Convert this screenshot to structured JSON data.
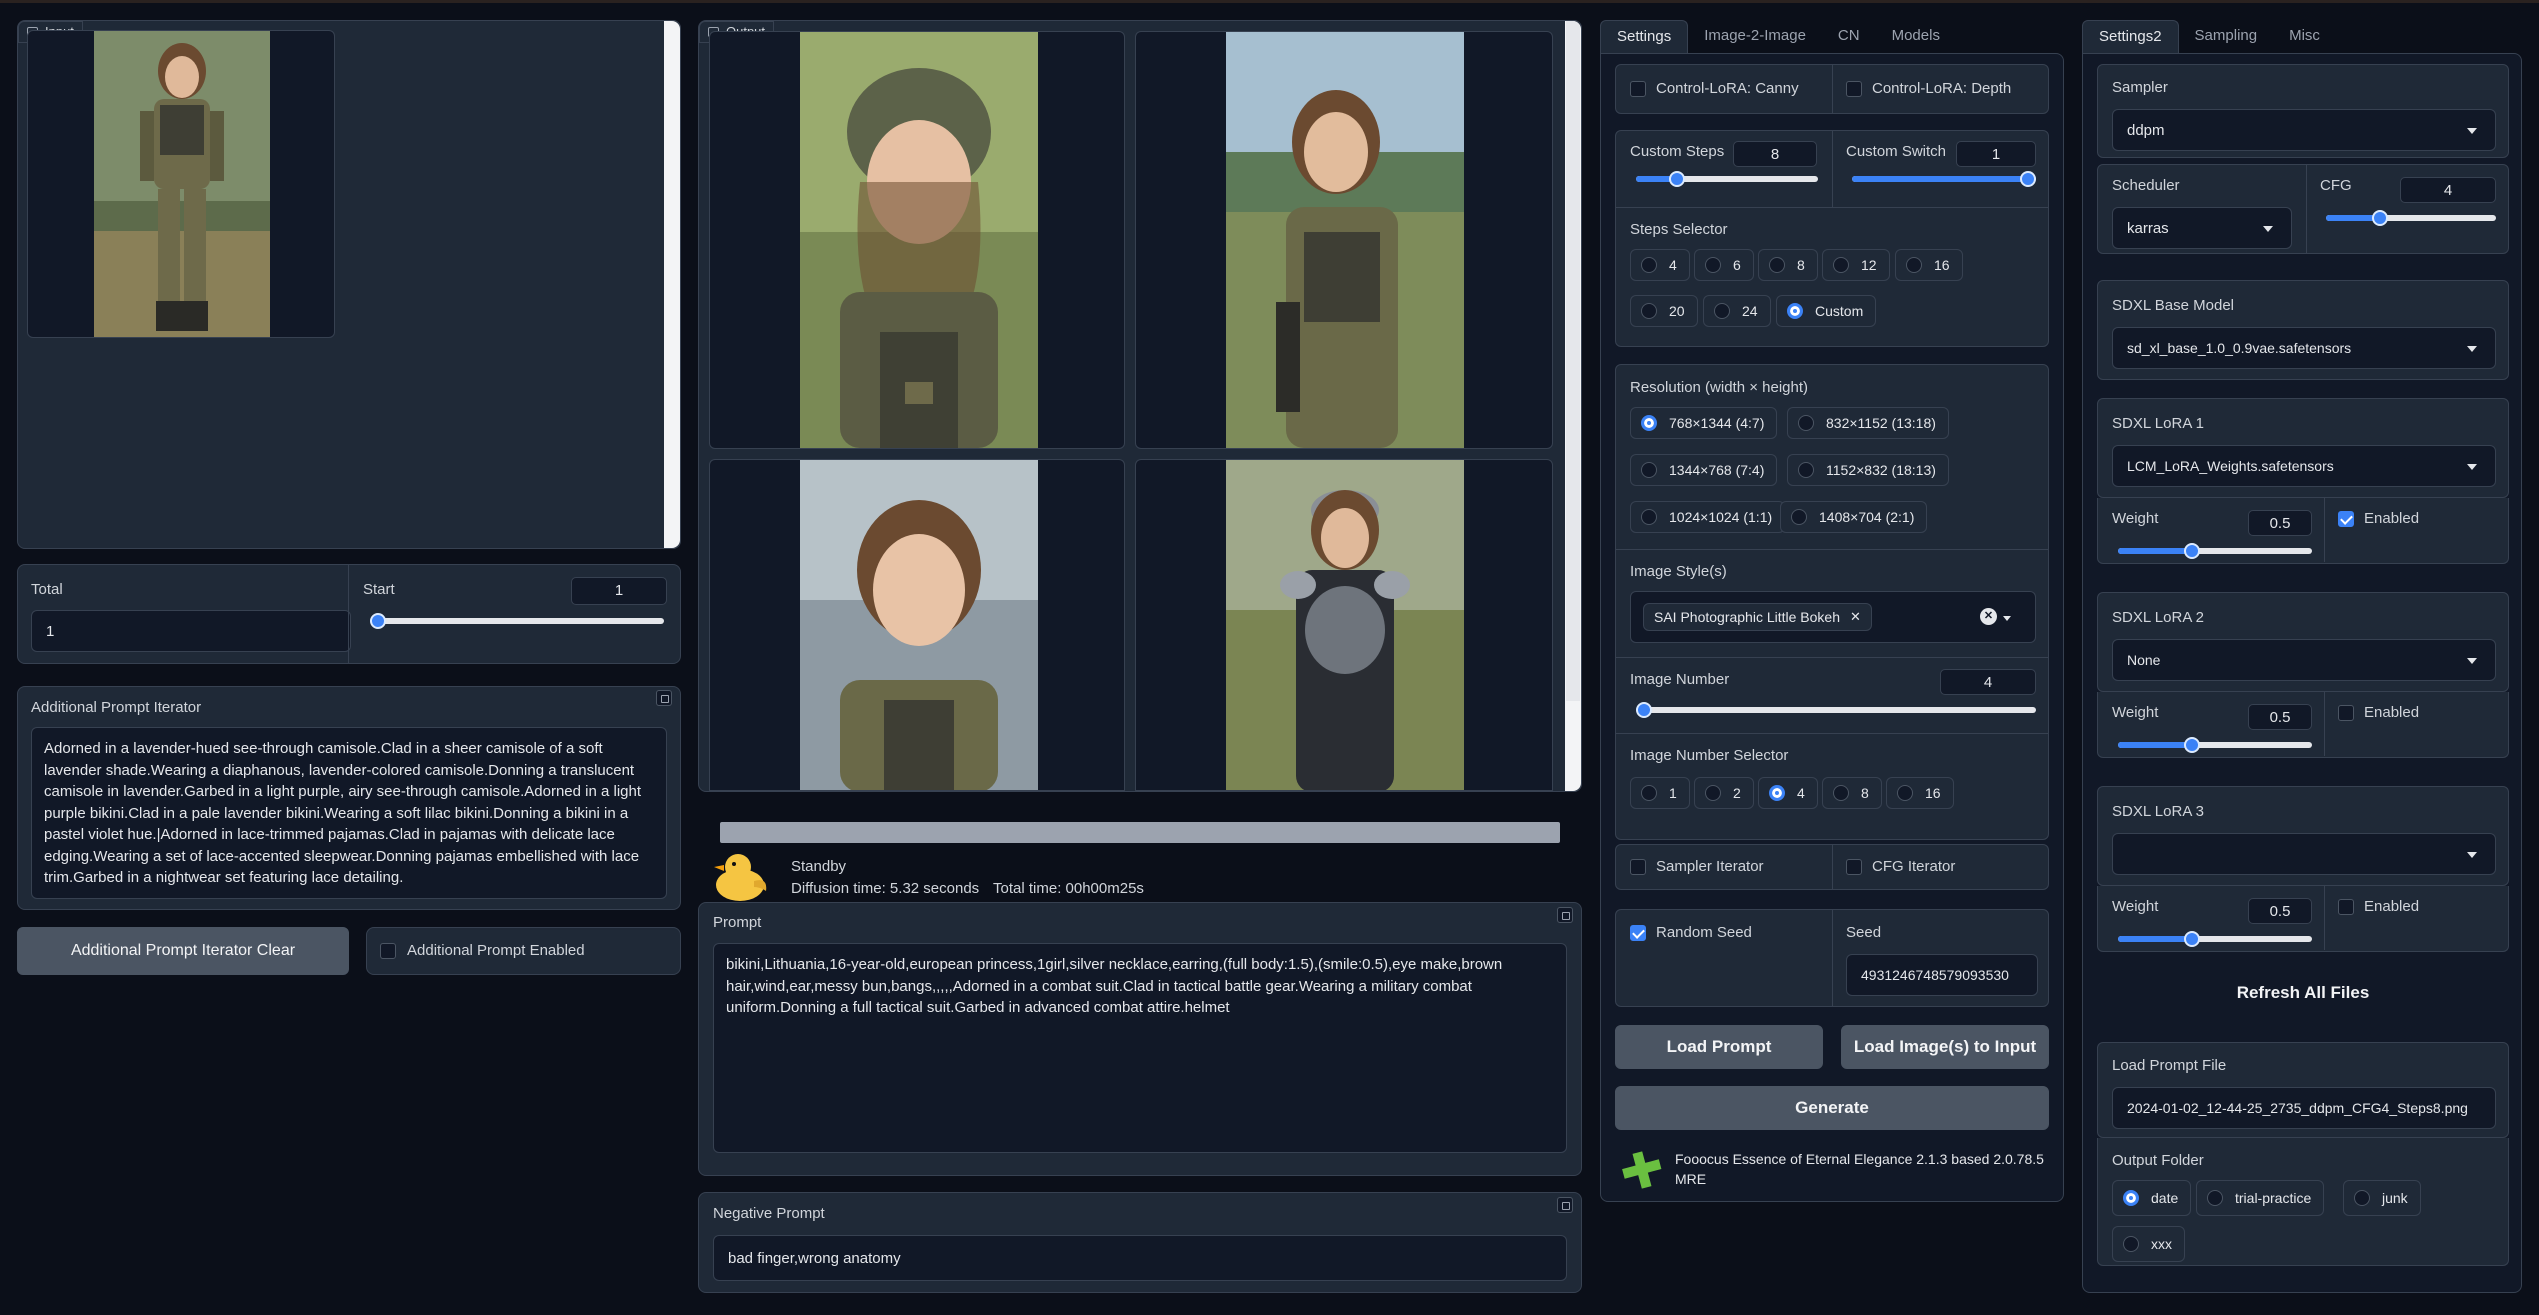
{
  "input_panel": {
    "label": "Input"
  },
  "output_panel": {
    "label": "Output"
  },
  "total": {
    "label": "Total",
    "value": "1"
  },
  "start": {
    "label": "Start",
    "value": "1",
    "fraction": 0
  },
  "iterator": {
    "label": "Additional Prompt Iterator",
    "text": "Adorned in a lavender-hued see-through camisole.Clad in a sheer camisole of a soft lavender shade.Wearing a diaphanous, lavender-colored camisole.Donning a translucent camisole in lavender.Garbed in a light purple, airy see-through camisole.Adorned in a light purple bikini.Clad in a pale lavender bikini.Wearing a soft lilac bikini.Donning a bikini in a pastel violet hue.|Adorned in lace-trimmed pajamas.Clad in pajamas with delicate lace edging.Wearing a set of lace-accented sleepwear.Donning pajamas embellished with lace trim.Garbed in a nightwear set featuring lace detailing.",
    "clear_button": "Additional Prompt Iterator Clear",
    "enabled_label": "Additional Prompt Enabled"
  },
  "status": {
    "state": "Standby",
    "diffusion": "Diffusion time: 5.32 seconds",
    "total": "Total time: 00h00m25s"
  },
  "prompt": {
    "label": "Prompt",
    "text": "bikini,Lithuania,16-year-old,european princess,1girl,silver necklace,earring,(full body:1.5),(smile:0.5),eye make,brown hair,wind,ear,messy bun,bangs,,,,,Adorned in a combat suit.Clad in tactical battle gear.Wearing a military combat uniform.Donning a full tactical suit.Garbed in advanced combat attire.helmet"
  },
  "negative": {
    "label": "Negative Prompt",
    "text": "bad finger,wrong anatomy"
  },
  "tabs_mid": [
    "Settings",
    "Image-2-Image",
    "CN",
    "Models"
  ],
  "tabs_right": [
    "Settings2",
    "Sampling",
    "Misc"
  ],
  "controlnet": {
    "canny": "Control-LoRA: Canny",
    "depth": "Control-LoRA: Depth"
  },
  "custom_steps": {
    "label": "Custom Steps",
    "value": "8",
    "fraction": 0.2
  },
  "custom_switch": {
    "label": "Custom Switch",
    "value": "1",
    "fraction": 1
  },
  "steps_selector": {
    "label": "Steps Selector",
    "options": [
      "4",
      "6",
      "8",
      "12",
      "16",
      "20",
      "24",
      "Custom"
    ],
    "selected": "Custom"
  },
  "resolution": {
    "label": "Resolution (width × height)",
    "options": [
      "768×1344 (4:7)",
      "832×1152 (13:18)",
      "1344×768 (7:4)",
      "1152×832 (18:13)",
      "1024×1024 (1:1)",
      "1408×704 (2:1)"
    ],
    "selected": "768×1344 (4:7)"
  },
  "style": {
    "label": "Image Style(s)",
    "value": "SAI Photographic Little Bokeh"
  },
  "image_number": {
    "label": "Image Number",
    "value": "4",
    "fraction": 0
  },
  "image_number_selector": {
    "label": "Image Number Selector",
    "options": [
      "1",
      "2",
      "4",
      "8",
      "16"
    ],
    "selected": "4"
  },
  "iterators": {
    "sampler": "Sampler Iterator",
    "cfg": "CFG Iterator"
  },
  "seed": {
    "random_label": "Random Seed",
    "label": "Seed",
    "value": "4931246748579093530"
  },
  "buttons": {
    "load_prompt": "Load Prompt",
    "load_images": "Load Image(s) to Input",
    "generate": "Generate"
  },
  "version": {
    "text": "Fooocus Essence of Eternal Elegance 2.1.3 based 2.0.78.5 MRE"
  },
  "sampler": {
    "label": "Sampler",
    "value": "ddpm"
  },
  "scheduler": {
    "label": "Scheduler",
    "value": "karras"
  },
  "cfg": {
    "label": "CFG",
    "value": "4",
    "fraction": 0.3
  },
  "base_model": {
    "label": "SDXL Base Model",
    "value": "sd_xl_base_1.0_0.9vae.safetensors"
  },
  "lora1": {
    "label": "SDXL LoRA 1",
    "value": "LCM_LoRA_Weights.safetensors",
    "weight_label": "Weight",
    "weight": "0.5",
    "fraction": 0.37,
    "enabled_label": "Enabled",
    "enabled": true
  },
  "lora2": {
    "label": "SDXL LoRA 2",
    "value": "None",
    "weight_label": "Weight",
    "weight": "0.5",
    "fraction": 0.37,
    "enabled_label": "Enabled",
    "enabled": false
  },
  "lora3": {
    "label": "SDXL LoRA 3",
    "value": "",
    "weight_label": "Weight",
    "weight": "0.5",
    "fraction": 0.37,
    "enabled_label": "Enabled",
    "enabled": false
  },
  "refresh": "Refresh All Files",
  "prompt_file": {
    "label": "Load Prompt File",
    "value": "2024-01-02_12-44-25_2735_ddpm_CFG4_Steps8.png"
  },
  "output_folder": {
    "label": "Output Folder",
    "options": [
      "date",
      "trial-practice",
      "junk",
      "xxx"
    ],
    "selected": "date"
  }
}
